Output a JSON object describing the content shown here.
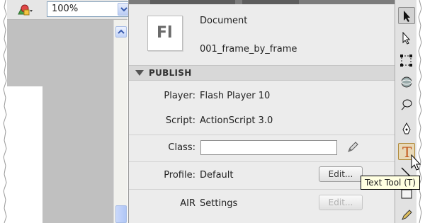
{
  "zoom": {
    "value": "100%"
  },
  "document": {
    "icon_text": "Fl",
    "type_label": "Document",
    "name": "001_frame_by_frame"
  },
  "publish": {
    "section_label": "PUBLISH",
    "player_label": "Player:",
    "player_value": "Flash Player 10",
    "script_label": "Script:",
    "script_value": "ActionScript 3.0",
    "class_label": "Class:",
    "class_value": "",
    "profile_label": "Profile:",
    "profile_value": "Default",
    "profile_edit": "Edit...",
    "air_label": "AIR",
    "air_value": "Settings",
    "air_edit": "Edit..."
  },
  "tooltip": {
    "text": "Text Tool (T)"
  },
  "tools": {
    "text_tool_glyph": "T",
    "icons": [
      "selection-icon",
      "subselection-icon",
      "free-transform-icon",
      "3d-rotation-icon",
      "lasso-icon",
      "pen-icon",
      "text-tool-icon",
      "line-icon",
      "rectangle-icon",
      "pencil-icon"
    ]
  },
  "colors": {
    "text_tool": "#c2561a",
    "tooltip_bg": "#ffffe1",
    "panel_bg": "#ececec"
  }
}
